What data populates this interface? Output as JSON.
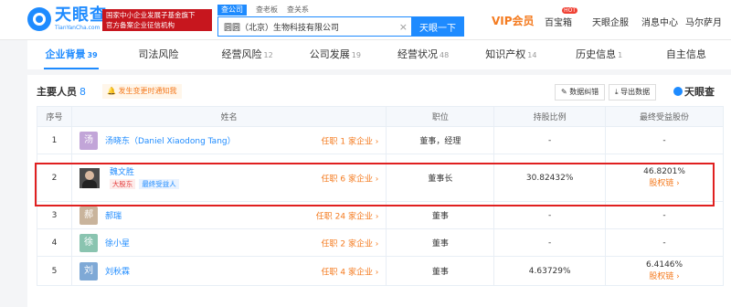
{
  "logo": {
    "cn": "天眼查",
    "en": "TianYanCha.com"
  },
  "gov_banner": {
    "line1": "国家中小企业发展子基金旗下",
    "line2": "官方备案企业征信机构"
  },
  "search": {
    "tabs": [
      "查公司",
      "查老板",
      "查关系"
    ],
    "value": "圆圆（北京）生物科技有限公司",
    "button": "天眼一下",
    "clear": "×"
  },
  "topnav": {
    "vip": "VIP会员",
    "baibao": "百宝箱",
    "hot": "HOT",
    "enterprise": "天眼企服",
    "message": "消息中心",
    "user": "马尔萨月"
  },
  "tabs": [
    {
      "label": "企业背景",
      "count": "39"
    },
    {
      "label": "司法风险",
      "count": ""
    },
    {
      "label": "经营风险",
      "count": "12"
    },
    {
      "label": "公司发展",
      "count": "19"
    },
    {
      "label": "经营状况",
      "count": "48"
    },
    {
      "label": "知识产权",
      "count": "14"
    },
    {
      "label": "历史信息",
      "count": "1"
    },
    {
      "label": "自主信息",
      "count": ""
    }
  ],
  "section": {
    "title": "主要人员",
    "count": "8",
    "notice": "发生变更时通知我",
    "btn_correct": "数据纠错",
    "btn_export": "导出数据",
    "brand": "天眼查"
  },
  "table": {
    "headers": [
      "序号",
      "姓名",
      "职位",
      "持股比例",
      "最终受益股份"
    ],
    "rows": [
      {
        "no": "1",
        "avatar": "汤",
        "avatar_color": "#c2a5d8",
        "name": "汤晓东（Daniel Xiaodong Tang）",
        "post": "任职 1 家企业 ›",
        "role": "董事，经理",
        "share": "-",
        "benefit": "-",
        "benefit_link": ""
      },
      {
        "no": "2",
        "avatar": "",
        "name": "魏文胜",
        "tag1": "大股东",
        "tag2": "最终受益人",
        "post": "任职 6 家企业 ›",
        "role": "董事长",
        "share": "30.82432%",
        "benefit": "46.8201%",
        "benefit_link": "股权链 ›"
      },
      {
        "no": "3",
        "avatar": "郝",
        "avatar_color": "#c9b49c",
        "name": "郝瑞",
        "post": "任职 24 家企业 ›",
        "role": "董事",
        "share": "-",
        "benefit": "-",
        "benefit_link": ""
      },
      {
        "no": "4",
        "avatar": "徐",
        "avatar_color": "#8ac4b0",
        "name": "徐小星",
        "post": "任职 2 家企业 ›",
        "role": "董事",
        "share": "-",
        "benefit": "-",
        "benefit_link": ""
      },
      {
        "no": "5",
        "avatar": "刘",
        "avatar_color": "#7fa9d6",
        "name": "刘秋霖",
        "post": "任职 4 家企业 ›",
        "role": "董事",
        "share": "4.63729%",
        "benefit": "6.4146%",
        "benefit_link": "股权链 ›"
      }
    ]
  }
}
